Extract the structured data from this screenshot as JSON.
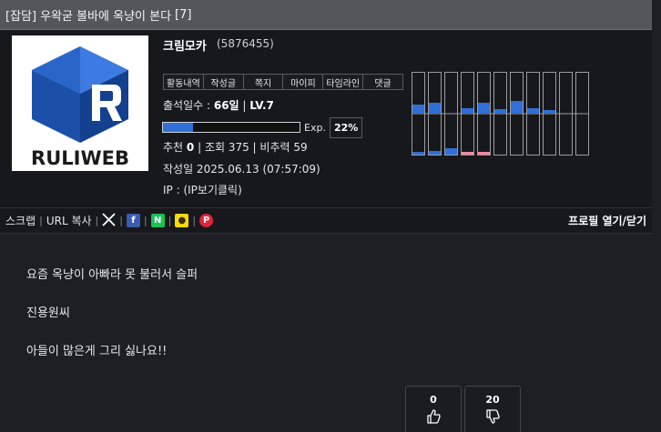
{
  "header": {
    "category": "[잡담]",
    "title": "우왁굳 볼바에 옥냥이 본다",
    "comment_count": "[7]"
  },
  "profile": {
    "logo_text": "RULIWEB",
    "nickname": "크림모카",
    "user_id": "(5876455)",
    "menu": [
      "활동내역",
      "작성글",
      "쪽지",
      "마이피",
      "타임라인",
      "댓글"
    ],
    "attend_label": "출석일수 : ",
    "attend_days": "66일",
    "level_sep": " | ",
    "level": "LV.7",
    "exp_label": "Exp.",
    "exp_percent": "22%",
    "exp_fraction": 0.22,
    "recommend_label": "추천 ",
    "recommend_value": "0",
    "views_label": " | 조회 375 | 비추력 59",
    "date_text": "작성일 2025.06.13 (07:57:09)",
    "ip_text": "IP : (IP보기클릭)"
  },
  "share": {
    "scrap": "스크랩",
    "sep": "|",
    "url_copy": "URL 복사",
    "profile_toggle": "프로필 열기/닫기",
    "icons": [
      "x-icon",
      "facebook-icon",
      "naver-icon",
      "kakao-icon",
      "pinterest-icon"
    ]
  },
  "body": {
    "lines": [
      "요즘 옥냥이 아빠라 못 불러서 슬퍼",
      "진용원씨",
      "아들이 많은게 그리 싫나요!!"
    ]
  },
  "votes": {
    "up": "0",
    "down": "20"
  },
  "colors": {
    "accent": "#2f6fd6",
    "pink": "#f08aa0",
    "bg": "#1e1f23"
  }
}
